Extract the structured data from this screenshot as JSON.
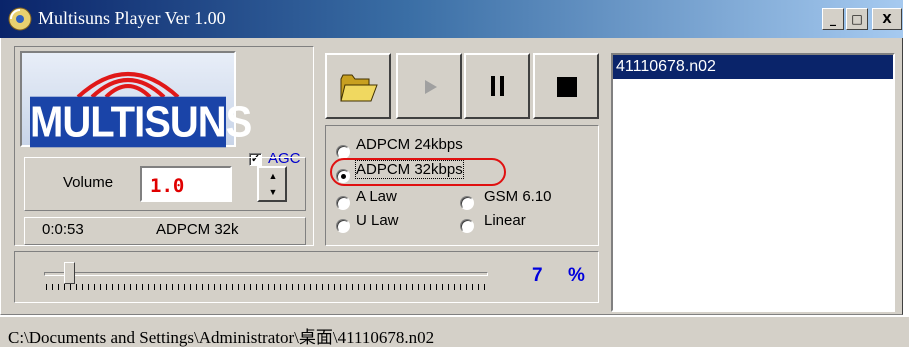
{
  "window": {
    "title": "Multisuns Player Ver 1.00",
    "controls": {
      "minimize": "_",
      "maximize": "□",
      "close": "X"
    }
  },
  "logo": {
    "text": "MULTISUNS"
  },
  "agc": {
    "label": "AGC",
    "checked": true
  },
  "volume": {
    "label": "Volume",
    "value": "1.0"
  },
  "status_info": {
    "time": "0:0:53",
    "codec": "ADPCM 32k"
  },
  "toolbar": {
    "open_icon": "folder-open-icon",
    "play_icon": "play-icon",
    "pause_icon": "pause-icon",
    "stop_icon": "stop-icon"
  },
  "codecs": {
    "options": [
      "ADPCM 24kbps",
      "ADPCM 32kbps",
      "A Law",
      "GSM 6.10",
      "U Law",
      "Linear"
    ],
    "selected": "ADPCM 32kbps"
  },
  "progress": {
    "value": "7",
    "unit": "%",
    "percent": 7
  },
  "playlist": {
    "items": [
      "41110678.n02"
    ],
    "selected_index": 0
  },
  "statusbar": {
    "path": "C:\\Documents and Settings\\Administrator\\桌面\\41110678.n02"
  },
  "colors": {
    "title_start": "#0a246a",
    "selection": "#0a246a",
    "agc_label": "#0000cc",
    "volume_value": "#e00000",
    "percent_text": "#0000dd",
    "highlight_ring": "#e01010"
  }
}
